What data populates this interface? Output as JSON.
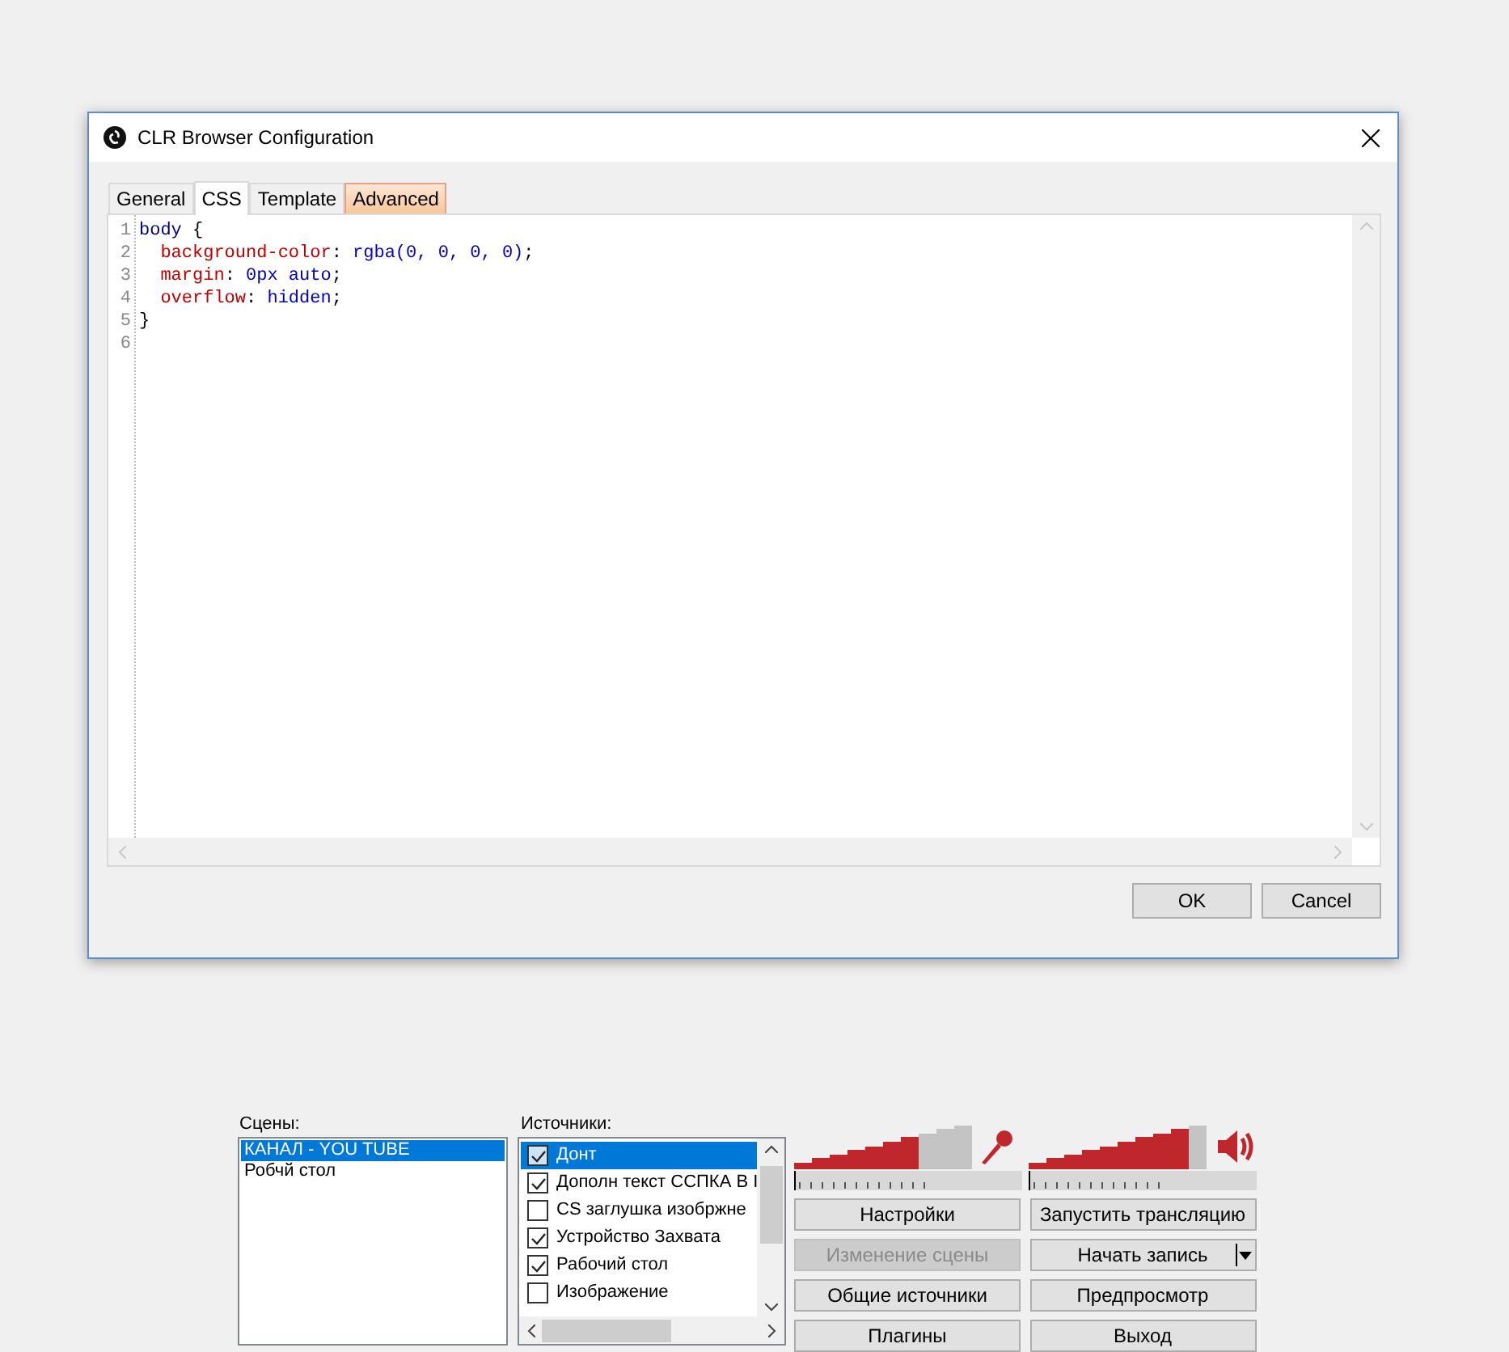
{
  "dialog": {
    "title": "CLR Browser Configuration",
    "tabs": [
      {
        "label": "General",
        "selected": false,
        "highlighted": false
      },
      {
        "label": "CSS",
        "selected": true,
        "highlighted": false
      },
      {
        "label": "Template",
        "selected": false,
        "highlighted": false
      },
      {
        "label": "Advanced",
        "selected": false,
        "highlighted": true
      }
    ],
    "code_lines": [
      {
        "number": "1",
        "tokens": [
          {
            "text": "body",
            "kind": "selector"
          },
          {
            "text": " {",
            "kind": "punct"
          }
        ]
      },
      {
        "number": "2",
        "tokens": [
          {
            "text": "  background-color",
            "kind": "property"
          },
          {
            "text": ": ",
            "kind": "punct"
          },
          {
            "text": "rgba(0, 0, 0, 0)",
            "kind": "value"
          },
          {
            "text": ";",
            "kind": "punct"
          }
        ]
      },
      {
        "number": "3",
        "tokens": [
          {
            "text": "  margin",
            "kind": "property"
          },
          {
            "text": ": ",
            "kind": "punct"
          },
          {
            "text": "0px auto",
            "kind": "value"
          },
          {
            "text": ";",
            "kind": "punct"
          }
        ]
      },
      {
        "number": "4",
        "tokens": [
          {
            "text": "  overflow",
            "kind": "property"
          },
          {
            "text": ": ",
            "kind": "punct"
          },
          {
            "text": "hidden",
            "kind": "value"
          },
          {
            "text": ";",
            "kind": "punct"
          }
        ]
      },
      {
        "number": "5",
        "tokens": [
          {
            "text": "}",
            "kind": "punct"
          }
        ]
      },
      {
        "number": "6"
      }
    ],
    "buttons": [
      "OK",
      "Cancel"
    ]
  },
  "scenes": {
    "label": "Сцены:",
    "items": [
      {
        "label": "КАНАЛ - YOU TUBE",
        "selected": true
      },
      {
        "label": "Робчй стол",
        "selected": false
      }
    ]
  },
  "sources": {
    "label": "Источники:",
    "items": [
      {
        "label": "Донт",
        "checked": true,
        "selected": true
      },
      {
        "label": "Дополн текст ССПКА В I",
        "checked": true,
        "selected": false
      },
      {
        "label": "CS заглушка изобржне",
        "checked": false,
        "selected": false
      },
      {
        "label": "Устройство Захвата",
        "checked": true,
        "selected": false
      },
      {
        "label": "Рабочий стол",
        "checked": true,
        "selected": false
      },
      {
        "label": "Изображение",
        "checked": false,
        "selected": false
      }
    ]
  },
  "meters": [
    {
      "kind": "microphone",
      "level": 0.7
    },
    {
      "kind": "speaker",
      "level": 0.9
    }
  ],
  "controls": [
    {
      "label": "Настройки",
      "disabled": false,
      "dropdown": false
    },
    {
      "label": "Запустить трансляцию",
      "disabled": false,
      "dropdown": false
    },
    {
      "label": "Изменение сцены",
      "disabled": true,
      "dropdown": false
    },
    {
      "label": "Начать запись",
      "disabled": false,
      "dropdown": true
    },
    {
      "label": "Общие источники",
      "disabled": false,
      "dropdown": false
    },
    {
      "label": "Предпросмотр",
      "disabled": false,
      "dropdown": false
    },
    {
      "label": "Плагины",
      "disabled": false,
      "dropdown": false
    },
    {
      "label": "Выход",
      "disabled": false,
      "dropdown": false
    }
  ]
}
